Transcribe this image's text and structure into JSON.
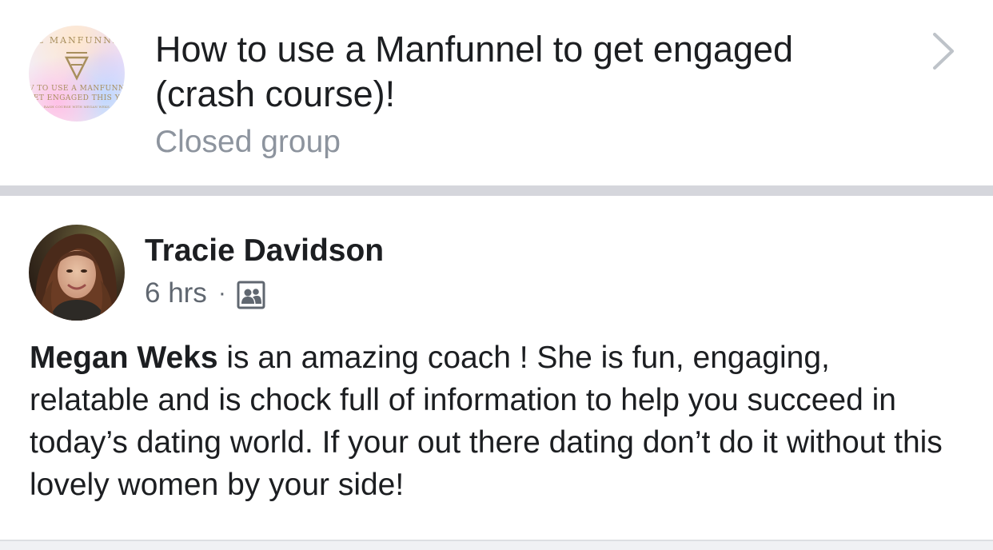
{
  "group": {
    "title_line1": "How to use a Manfunnel to get engaged",
    "title_line2": "(crash course)!",
    "type": "Closed group",
    "cover": {
      "text_top": "E MANFUNN.",
      "text_mid1": "V TO USE A MANFUNN",
      "text_mid2": "ET ENGAGED THIS Y",
      "text_small": "RASH COURSE WITH MEGAN WEKS",
      "accent_color": "#a88f5d"
    }
  },
  "post": {
    "author": "Tracie Davidson",
    "time": "6 hrs",
    "separator": "·",
    "audience_icon": "group-audience-icon",
    "mention": "Megan Weks",
    "body": " is an amazing coach ! She is fun, engaging, relatable and is chock full of information to help you succeed in today’s dating world. If your out there dating don’t do it without this lovely women  by your side!"
  },
  "icons": {
    "chevron": "chevron-right-icon"
  },
  "colors": {
    "primary_text": "#1c1e21",
    "secondary_text": "#8d949e",
    "meta_text": "#606770",
    "divider": "#d5d6dc"
  }
}
